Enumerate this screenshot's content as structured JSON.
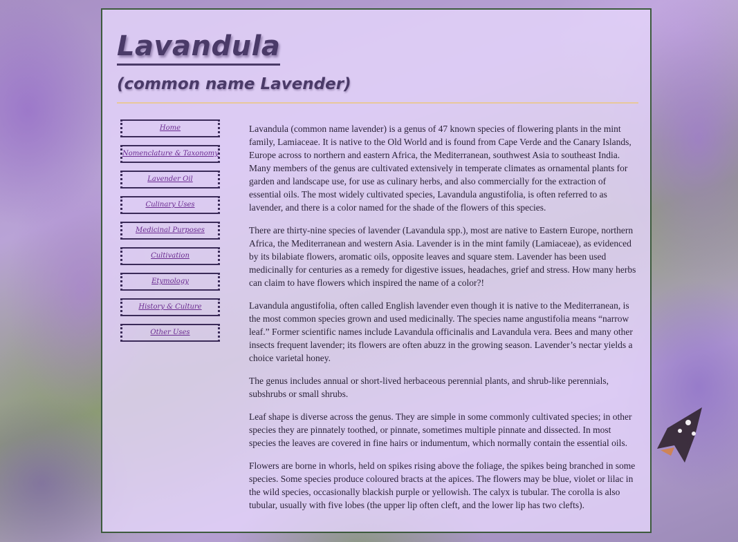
{
  "header": {
    "title": "Lavandula",
    "subtitle": "(common name Lavender)"
  },
  "nav": {
    "items": [
      {
        "label": "Home"
      },
      {
        "label": "Nomenclature & Taxonomy"
      },
      {
        "label": "Lavender Oil"
      },
      {
        "label": "Culinary Uses"
      },
      {
        "label": "Medicinal Purposes"
      },
      {
        "label": "Cultivation"
      },
      {
        "label": "Etymology"
      },
      {
        "label": "History & Culture"
      },
      {
        "label": "Other Uses"
      }
    ]
  },
  "content": {
    "paragraphs": [
      "Lavandula (common name lavender) is a genus of 47 known species of flowering plants in the mint family, Lamiaceae. It is native to the Old World and is found from Cape Verde and the Canary Islands, Europe across to northern and eastern Africa, the Mediterranean, southwest Asia to southeast India. Many members of the genus are cultivated extensively in temperate climates as ornamental plants for garden and landscape use, for use as culinary herbs, and also commercially for the extraction of essential oils. The most widely cultivated species, Lavandula angustifolia, is often referred to as lavender, and there is a color named for the shade of the flowers of this species.",
      "There are thirty-nine species of lavender (Lavandula spp.), most are native to Eastern Europe, northern Africa, the Mediterranean and western Asia. Lavender is in the mint family (Lamiaceae), as evidenced by its bilabiate flowers, aromatic oils, opposite leaves and square stem. Lavender has been used medicinally for centuries as a remedy for digestive issues, headaches, grief and stress. How many herbs can claim to have flowers which inspired the name of a color?!",
      "Lavandula angustifolia, often called English lavender even though it is native to the Mediterranean, is the most common species grown and used medicinally. The species name angustifolia means “narrow leaf.” Former scientific names include Lavandula officinalis and Lavandula vera. Bees and many other insects frequent lavender; its flowers are often abuzz in the growing season. Lavender’s nectar yields a choice varietal honey.",
      "The genus includes annual or short-lived herbaceous perennial plants, and shrub-like perennials, subshrubs or small shrubs.",
      "Leaf shape is diverse across the genus. They are simple in some commonly cultivated species; in other species they are pinnately toothed, or pinnate, sometimes multiple pinnate and dissected. In most species the leaves are covered in fine hairs or indumentum, which normally contain the essential oils.",
      "Flowers are borne in whorls, held on spikes rising above the foliage, the spikes being branched in some species. Some species produce coloured bracts at the apices. The flowers may be blue, violet or lilac in the wild species, occasionally blackish purple or yellowish. The calyx is tubular. The corolla is also tubular, usually with five lobes (the upper lip often cleft, and the lower lip has two clefts)."
    ]
  },
  "colors": {
    "panel_background": "#e4d4fa",
    "panel_border": "#3c5a3c",
    "title_color": "#4a3a68",
    "rule_color": "#e8c89a",
    "nav_link_color": "#6a2a90",
    "body_text_color": "#2a2238"
  }
}
